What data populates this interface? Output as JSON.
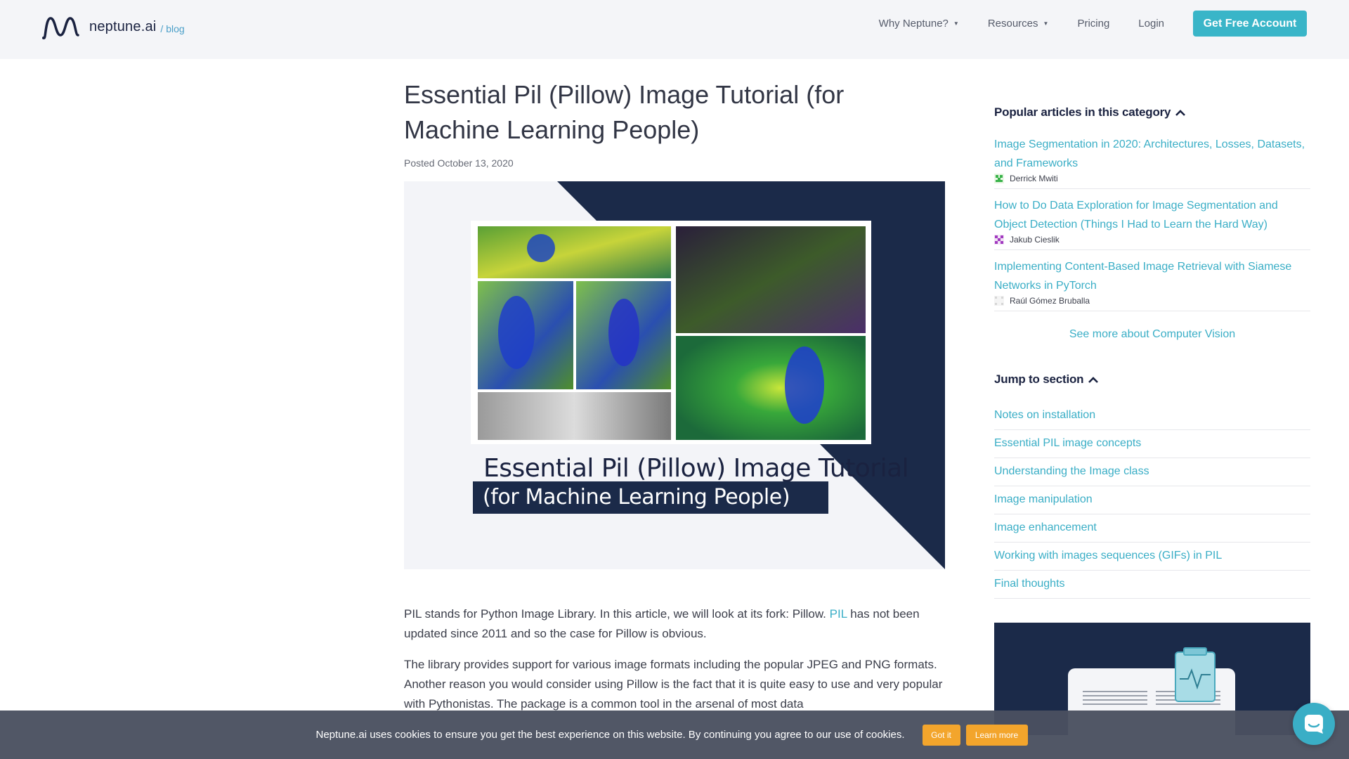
{
  "header": {
    "logo_text": "neptune.ai",
    "logo_blog": "/ blog",
    "nav": [
      {
        "label": "Why Neptune?",
        "dropdown": true
      },
      {
        "label": "Resources",
        "dropdown": true
      },
      {
        "label": "Pricing",
        "dropdown": false
      },
      {
        "label": "Login",
        "dropdown": false
      }
    ],
    "cta_label": "Get Free Account"
  },
  "article": {
    "title": "Essential Pil (Pillow) Image Tutorial (for Machine Learning People)",
    "posted": "Posted October 13, 2020",
    "hero": {
      "title": "Essential Pil (Pillow) Image Tutorial",
      "subtitle": "(for Machine Learning People)"
    },
    "para1_before_link": "PIL stands for Python Image Library. In this article, we will look at its fork: Pillow. ",
    "para1_link": "PIL",
    "para1_after_link": " has not been updated since 2011 and so the case for Pillow is obvious.",
    "para2": "The library provides support for various image formats including the popular JPEG and PNG formats. Another reason you would consider using Pillow is the fact that it is quite easy to use and very popular with Pythonistas. The package is a common tool in the arsenal of most data"
  },
  "sidebar": {
    "popular_heading": "Popular articles in this category",
    "popular": [
      {
        "title": "Image Segmentation in 2020: Architectures, Losses, Datasets, and Frameworks",
        "author": "Derrick Mwiti"
      },
      {
        "title": "How to Do Data Exploration for Image Segmentation and Object Detection (Things I Had to Learn the Hard Way)",
        "author": "Jakub Cieslik"
      },
      {
        "title": "Implementing Content-Based Image Retrieval with Siamese Networks in PyTorch",
        "author": "Raúl Gómez Bruballa"
      }
    ],
    "see_more": "See more about Computer Vision",
    "jump_heading": "Jump to section",
    "jump": [
      "Notes on installation",
      "Essential PIL image concepts",
      "Understanding the Image class",
      "Image manipulation",
      "Image enhancement",
      "Working with images sequences (GIFs) in PIL",
      "Final thoughts"
    ]
  },
  "cookie": {
    "text": "Neptune.ai uses cookies to ensure you get the best experience on this website. By continuing you agree to our use of cookies.",
    "got_it": "Got it",
    "learn_more": "Learn more"
  },
  "colors": {
    "accent": "#3aaec6",
    "cta": "#39b5c8",
    "navy": "#1b2a49",
    "cookie_button": "#f3a52c"
  }
}
